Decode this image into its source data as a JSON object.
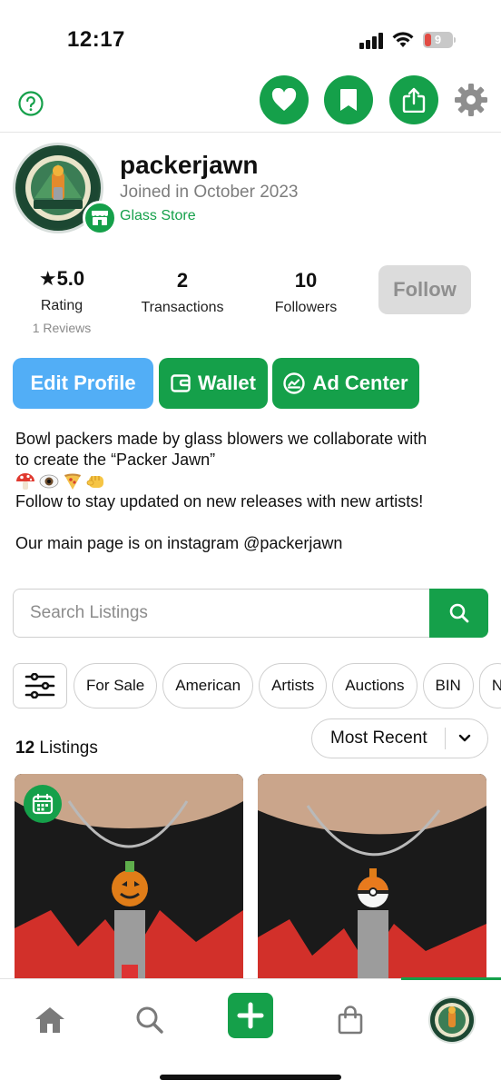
{
  "status_bar": {
    "time": "12:17",
    "battery": "9"
  },
  "colors": {
    "accent": "#15a04a",
    "edit_profile": "#52aef6",
    "follow_disabled": "#dcdcdc"
  },
  "top_actions": {
    "help_icon": "question-circle-icon",
    "like_icon": "heart-icon",
    "save_icon": "bookmark-icon",
    "share_icon": "share-icon",
    "settings_icon": "gear-icon"
  },
  "profile": {
    "username": "packerjawn",
    "joined": "Joined in October 2023",
    "store_type": "Glass Store",
    "avatar_text": "THE PACKER JAWN"
  },
  "stats": {
    "rating_value": "5.0",
    "rating_label": "Rating",
    "reviews": "1 Reviews",
    "transactions_value": "2",
    "transactions_label": "Transactions",
    "followers_value": "10",
    "followers_label": "Followers"
  },
  "buttons": {
    "follow": "Follow",
    "edit_profile": "Edit Profile",
    "wallet": "Wallet",
    "ad_center": "Ad Center"
  },
  "bio": {
    "line1": "Bowl packers made by glass blowers we collaborate with",
    "line2": "to create the “Packer Jawn”",
    "line3": "Follow to stay updated on new releases with new artists!",
    "line4": "Our main page is on instagram @packerjawn"
  },
  "search": {
    "placeholder": "Search Listings"
  },
  "filter_chips": [
    "For Sale",
    "American",
    "Artists",
    "Auctions",
    "BIN",
    "N"
  ],
  "listings": {
    "count": "12",
    "count_label": "Listings",
    "sort": "Most Recent"
  },
  "tab_bar": {
    "home_icon": "home-icon",
    "search_icon": "search-icon",
    "add_icon": "plus-icon",
    "shop_icon": "shopping-bag-icon",
    "profile_icon": "avatar"
  }
}
